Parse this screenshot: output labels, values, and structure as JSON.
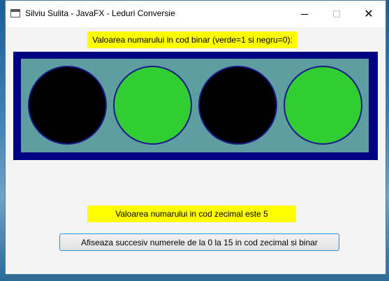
{
  "window": {
    "title": "Silviu Sulita - JavaFX - Leduri Conversie",
    "controls": {
      "minimize_icon": "minimize-icon",
      "maximize_icon": "maximize-icon",
      "close_icon": "close-icon",
      "close_glyph": "✕"
    }
  },
  "binary_label": "Valoarea numarului in cod binar (verde=1 si negru=0):",
  "leds": [
    {
      "bit": 0,
      "color": "#000000"
    },
    {
      "bit": 1,
      "color": "#32cd32"
    },
    {
      "bit": 0,
      "color": "#000000"
    },
    {
      "bit": 1,
      "color": "#32cd32"
    }
  ],
  "decimal_label": "Valoarea numarului in cod zecimal este 5",
  "action_button": "Afiseaza succesiv numerele de la 0 la 15 in cod zecimal si binar",
  "colors": {
    "label_background": "#ffff00",
    "panel_border": "#000080",
    "panel_fill": "#5f9ea0",
    "led_on": "#32cd32",
    "led_off": "#000000"
  }
}
